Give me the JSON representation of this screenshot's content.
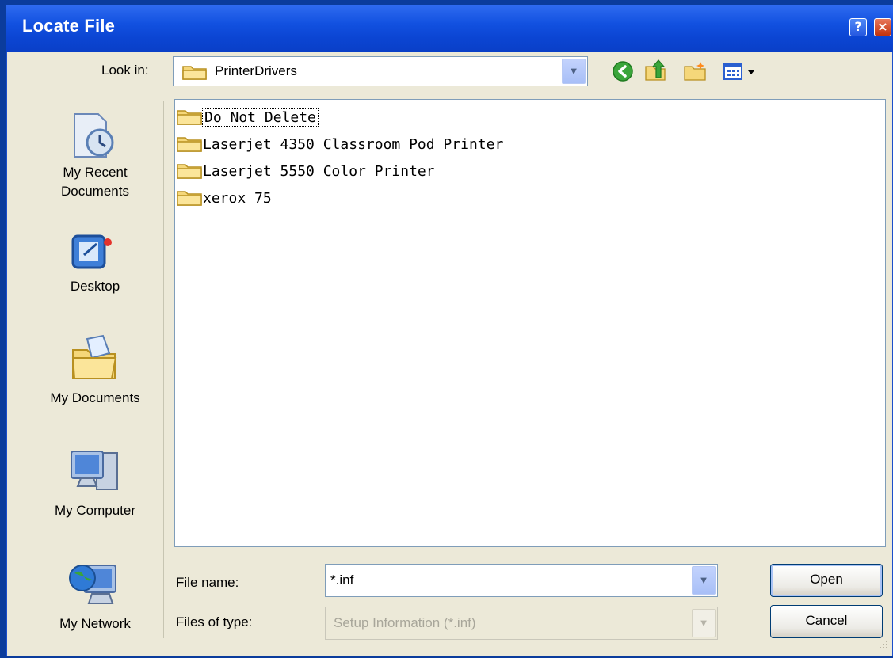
{
  "window": {
    "title": "Locate File",
    "help_label": "?",
    "close_label": "×"
  },
  "look_in": {
    "label": "Look in:",
    "value": "PrinterDrivers"
  },
  "places": [
    {
      "label_lines": [
        "My Recent",
        "Documents"
      ]
    },
    {
      "label_lines": [
        "Desktop"
      ]
    },
    {
      "label_lines": [
        "My Documents"
      ]
    },
    {
      "label_lines": [
        "My Computer"
      ]
    },
    {
      "label_lines": [
        "My Network"
      ]
    }
  ],
  "files": [
    "Do Not Delete",
    "Laserjet 4350 Classroom Pod Printer",
    "Laserjet 5550 Color Printer",
    "xerox 75"
  ],
  "file_name": {
    "label": "File name:",
    "value": "*.inf"
  },
  "file_type": {
    "label": "Files of type:",
    "value": "Setup Information (*.inf)"
  },
  "buttons": {
    "open": "Open",
    "cancel": "Cancel"
  },
  "colors": {
    "titlebar": "#0a3fc7",
    "dialog": "#ece9d8",
    "folder": "#f5d77a",
    "field_border": "#7f9db9"
  }
}
